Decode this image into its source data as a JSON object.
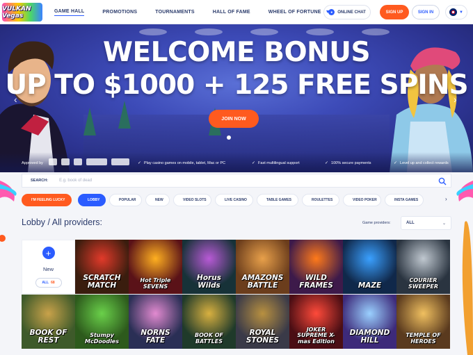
{
  "header": {
    "logo_text": "VULKAN Vegas",
    "nav": [
      {
        "label": "GAME HALL",
        "active": true
      },
      {
        "label": "PROMOTIONS"
      },
      {
        "label": "TOURNAMENTS"
      },
      {
        "label": "HALL OF FAME"
      },
      {
        "label": "WHEEL OF FORTUNE"
      }
    ],
    "chat_label": "ONLINE CHAT",
    "signup_label": "SIGN UP",
    "signin_label": "SIGN IN",
    "language": "en-GB"
  },
  "hero": {
    "title_line1": "WELCOME BONUS",
    "title_line2": "UP TO $1000 + 125 FREE SPINS",
    "cta_label": "JOIN NOW",
    "approved_label": "Approved by",
    "features": [
      "Play casino games on mobile, tablet, Mac or PC",
      "Fast multilingual support",
      "100% secure payments",
      "Level up and collect rewards"
    ]
  },
  "search": {
    "label": "SEARCH:",
    "placeholder": "E.g. book of dead"
  },
  "filters": [
    {
      "label": "I'M FEELING LUCKY",
      "style": "lucky"
    },
    {
      "label": "LOBBY",
      "style": "lobby"
    },
    {
      "label": "POPULAR"
    },
    {
      "label": "NEW"
    },
    {
      "label": "VIDEO SLOTS"
    },
    {
      "label": "LIVE CASINO"
    },
    {
      "label": "TABLE GAMES"
    },
    {
      "label": "ROULETTES"
    },
    {
      "label": "VIDEO POKER"
    },
    {
      "label": "INSTA GAMES"
    }
  ],
  "lobby": {
    "title": "Lobby / All providers:",
    "providers_label": "Game providers:",
    "providers_value": "ALL",
    "new_tile": {
      "label": "New",
      "all_label": "ALL",
      "count": "68"
    }
  },
  "games": [
    {
      "name": "SCRATCH MATCH",
      "bg": "#3a1d0e",
      "accent": "#e23a2a"
    },
    {
      "name": "Hot Triple SEVENS",
      "bg": "#5a1218",
      "accent": "#ffb020"
    },
    {
      "name": "Horus Wilds",
      "bg": "#173238",
      "accent": "#b85ad6"
    },
    {
      "name": "AMAZONS BATTLE",
      "bg": "#6b3d1c",
      "accent": "#e8a04a"
    },
    {
      "name": "WILD FRAMES",
      "bg": "#3d1a4a",
      "accent": "#ff7a1a"
    },
    {
      "name": "MAZE",
      "bg": "#10284a",
      "accent": "#3aa0ff"
    },
    {
      "name": "COURIER SWEEPER",
      "bg": "#2a3440",
      "accent": "#c0c8d0"
    },
    {
      "name": "BOOK OF REST",
      "bg": "#3e5a2a",
      "accent": "#c9a24a"
    },
    {
      "name": "Stumpy McDoodles",
      "bg": "#2d5a1c",
      "accent": "#6ad04a"
    },
    {
      "name": "NORNS FATE",
      "bg": "#2a2f55",
      "accent": "#e28ad0"
    },
    {
      "name": "BOOK OF BATTLES",
      "bg": "#1f3a2a",
      "accent": "#d8b040"
    },
    {
      "name": "ROYAL STONES",
      "bg": "#3a3a48",
      "accent": "#b89040"
    },
    {
      "name": "JOKER SUPREME X-mas Edition",
      "bg": "#4a0e14",
      "accent": "#ff4a3a"
    },
    {
      "name": "DIAMOND HILL",
      "bg": "#3d2a7a",
      "accent": "#9ad0ff"
    },
    {
      "name": "TEMPLE OF HEROES",
      "bg": "#5a3a1e",
      "accent": "#f0c060"
    }
  ]
}
